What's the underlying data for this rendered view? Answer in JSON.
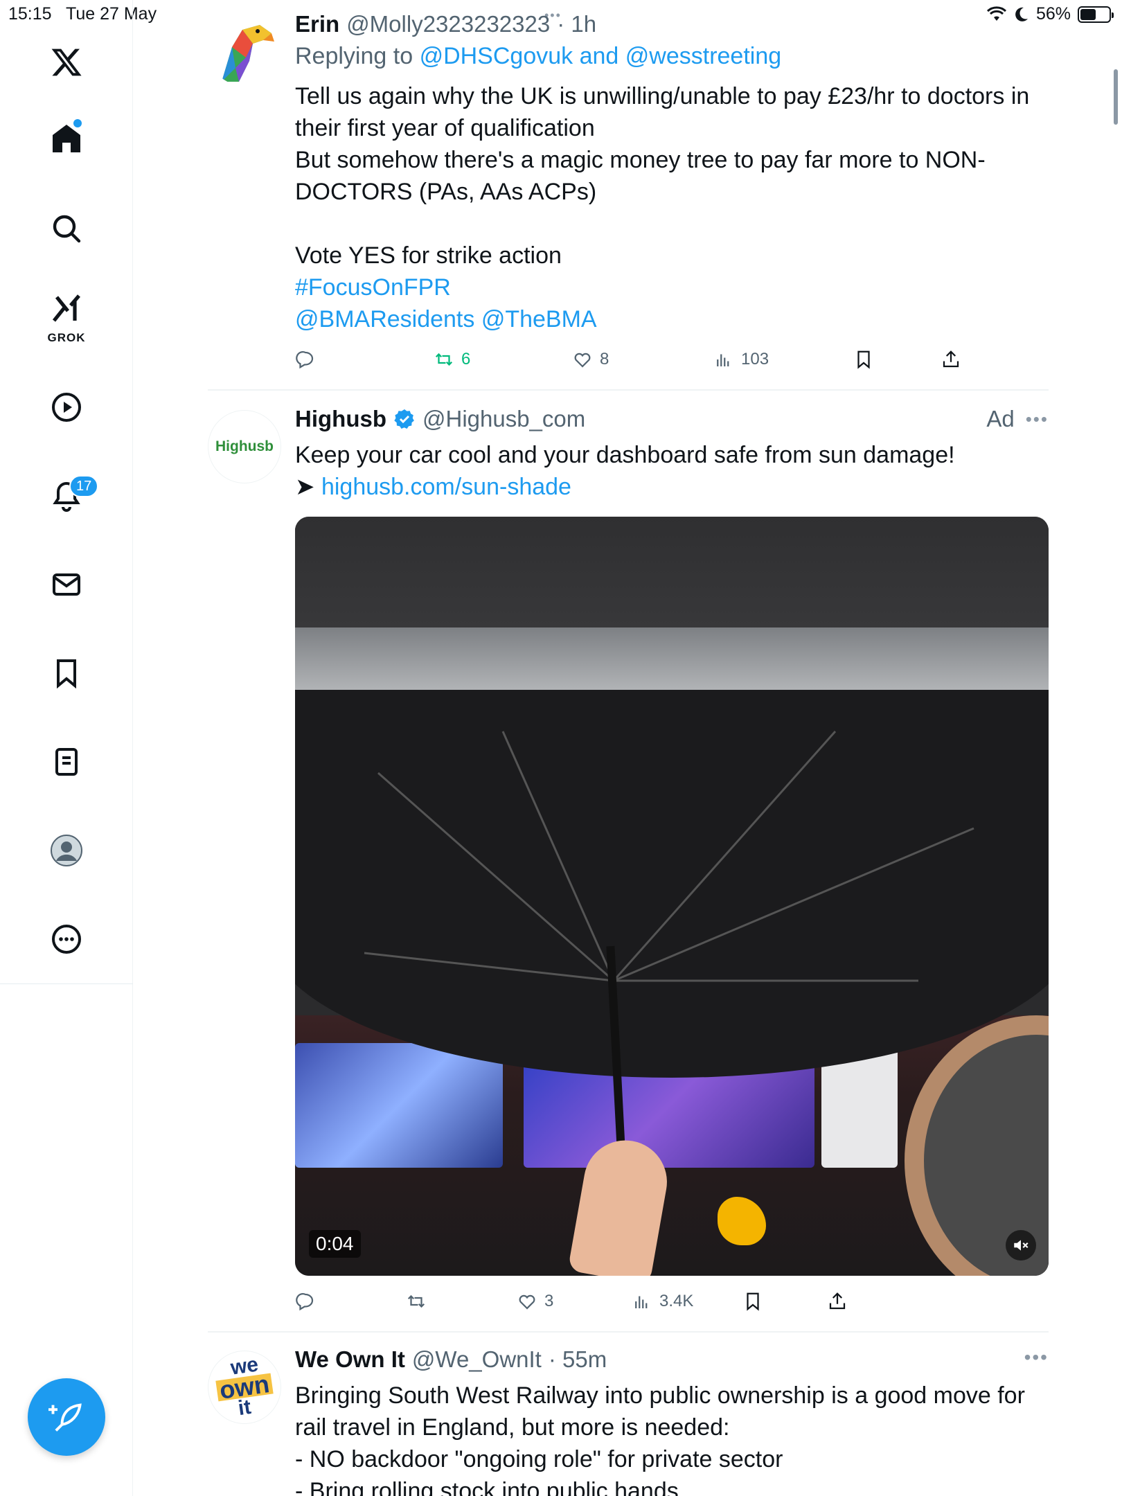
{
  "status_bar": {
    "time": "15:15",
    "date": "Tue 27 May",
    "battery": "56%",
    "battery_level": 0.56
  },
  "sidebar": {
    "notifications_badge": "17",
    "grok_label": "GROK",
    "icons": [
      "x-logo-icon",
      "home-icon",
      "search-icon",
      "grok-icon",
      "video-icon",
      "notifications-icon",
      "messages-icon",
      "bookmarks-icon",
      "lists-icon",
      "profile-icon",
      "more-icon"
    ],
    "compose_icon": "compose-post-icon"
  },
  "tweets": [
    {
      "name": "Erin",
      "handle": "@Molly2323232323",
      "time": "· 1h",
      "replying_prefix": "Replying to",
      "replying_to": "@DHSCgovuk and @wesstreeting",
      "text_lines": [
        "Tell us again why the UK is unwilling/unable to pay £23/hr to doctors in",
        "their first year of qualification",
        "But somehow there's a magic money tree to pay far more to NON-",
        "DOCTORS (PAs, AAs ACPs)",
        "",
        "Vote YES for strike action"
      ],
      "hashtag": "#FocusOnFPR",
      "mentions": "@BMAResidents @TheBMA",
      "retweets": "6",
      "likes": "8",
      "views": "103"
    },
    {
      "name": "Highusb",
      "handle": "@Highusb_com",
      "ad_label": "Ad",
      "avatar_text": "Highusb",
      "text": "Keep your car cool and your dashboard safe from sun damage!",
      "arrow": "➤",
      "link": "highusb.com/sun-shade",
      "video_time": "0:04",
      "likes": "3",
      "views": "3.4K"
    },
    {
      "name": "We Own It",
      "handle": "@We_OwnIt",
      "time": "· 55m",
      "avatar_lines": [
        "we",
        "own",
        "it"
      ],
      "text_lines": [
        "Bringing South West Railway into public ownership is a good move for",
        "rail travel in England, but more is needed:",
        "- NO backdoor \"ongoing role\" for private sector",
        "- Bring rolling stock into public hands"
      ]
    }
  ],
  "colors": {
    "accent": "#1d9bf0",
    "retweet_green": "#00ba7c",
    "secondary_text": "#536471"
  }
}
